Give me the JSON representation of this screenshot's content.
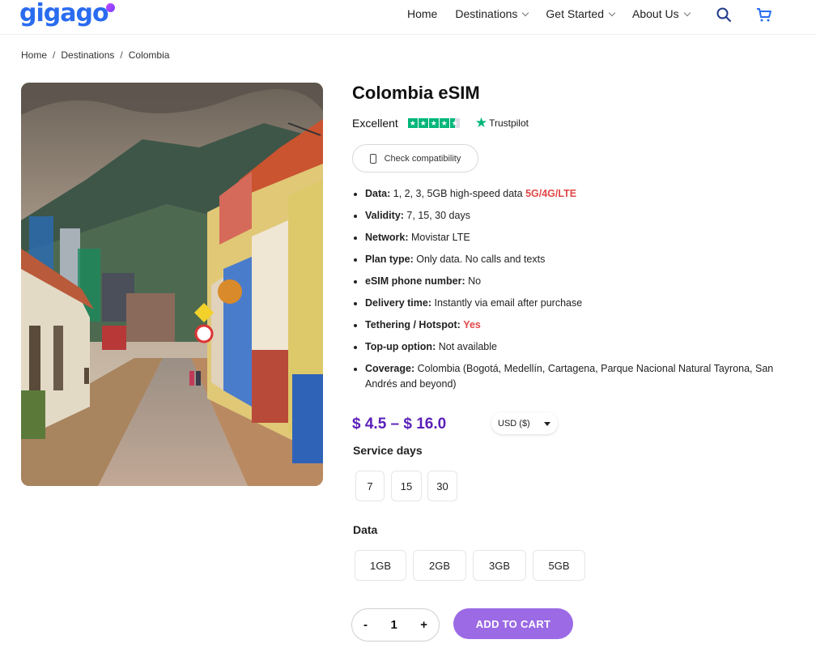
{
  "brand": {
    "logo_text": "gigago",
    "accent": "#2a6cf0",
    "purple": "#5a1fb8",
    "button_color": "#9b6ae4"
  },
  "nav": {
    "items": [
      {
        "label": "Home",
        "has_dropdown": false
      },
      {
        "label": "Destinations",
        "has_dropdown": true
      },
      {
        "label": "Get Started",
        "has_dropdown": true
      },
      {
        "label": "About Us",
        "has_dropdown": true
      }
    ],
    "icons": [
      "search-icon",
      "cart-icon"
    ]
  },
  "breadcrumb": [
    "Home",
    "Destinations",
    "Colombia"
  ],
  "product": {
    "title": "Colombia eSIM",
    "rating_label": "Excellent",
    "trustpilot_label": "Trustpilot",
    "compat_label": "Check compatibility",
    "features": [
      {
        "key": "Data:",
        "value": "1, 2, 3, 5GB high-speed data ",
        "extra": "5G/4G/LTE"
      },
      {
        "key": "Validity:",
        "value": "7, 15, 30 days",
        "extra": ""
      },
      {
        "key": "Network:",
        "value": "Movistar LTE",
        "extra": ""
      },
      {
        "key": "Plan type:",
        "value": "Only data. No calls and texts",
        "extra": ""
      },
      {
        "key": "eSIM phone number:",
        "value": "No",
        "extra": ""
      },
      {
        "key": "Delivery time:",
        "value": "Instantly via email after purchase",
        "extra": ""
      },
      {
        "key": "Tethering / Hotspot:",
        "value": "",
        "extra": "Yes"
      },
      {
        "key": "Top-up option:",
        "value": "Not available",
        "extra": ""
      },
      {
        "key": "Coverage:",
        "value": "Colombia (Bogotá, Medellín, Cartagena, Parque Nacional Natural Tayrona, San Andrés and beyond)",
        "extra": ""
      }
    ],
    "price": "$ 4.5 – $ 16.0",
    "currency": "USD ($)",
    "service_days_label": "Service days",
    "service_days": [
      "7",
      "15",
      "30"
    ],
    "data_label": "Data",
    "data_options": [
      "1GB",
      "2GB",
      "3GB",
      "5GB"
    ],
    "quantity": "1",
    "qty_minus": "-",
    "qty_plus": "+",
    "add_to_cart": "ADD TO CART"
  }
}
